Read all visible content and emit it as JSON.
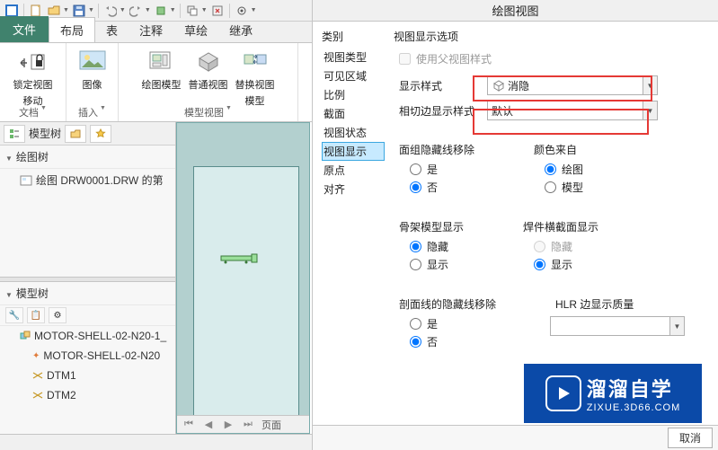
{
  "qat": {},
  "ribbon": {
    "tabs": {
      "file": "文件",
      "layout": "布局",
      "table": "表",
      "annotate": "注释",
      "sketch": "草绘",
      "inherit": "继承"
    },
    "groups": {
      "doc": {
        "lock_label1": "锁定视图",
        "lock_label2": "移动",
        "title": "文档"
      },
      "insert": {
        "image": "图像",
        "title": "插入"
      },
      "modelview": {
        "drawmodel": "绘图模型",
        "normalview": "普通视图",
        "replace_l1": "替换视图",
        "replace_l2": "模型",
        "title": "模型视图"
      }
    }
  },
  "leftpanel": {
    "tab_modeltree": "模型树",
    "tree_title": "绘图树",
    "drw_item": "绘图 DRW0001.DRW 的第",
    "tree2_title": "模型树",
    "item_asm1": "MOTOR-SHELL-02-N20-1_",
    "item_asm2": "MOTOR-SHELL-02-N20",
    "dtm1": "DTM1",
    "dtm2": "DTM2"
  },
  "drawnav": {
    "page": "页面"
  },
  "dialog": {
    "title": "绘图视图",
    "category_label": "类别",
    "categories": {
      "viewtype": "视图类型",
      "visiblearea": "可见区域",
      "scale": "比例",
      "section": "截面",
      "viewstate": "视图状态",
      "viewdisplay": "视图显示",
      "origin": "原点",
      "align": "对齐"
    },
    "options_label": "视图显示选项",
    "use_parent": "使用父视图样式",
    "display_style_label": "显示样式",
    "display_style_value": "消隐",
    "tangent_label": "相切边显示样式",
    "tangent_value": "默认",
    "facehidden_title": "面组隐藏线移除",
    "yes": "是",
    "no": "否",
    "colorfrom_title": "颜色来自",
    "color_draw": "绘图",
    "color_model": "模型",
    "skeleton_title": "骨架模型显示",
    "hide": "隐藏",
    "show": "显示",
    "weldcs_title": "焊件横截面显示",
    "hatchhidden_title": "剖面线的隐藏线移除",
    "hlr_title": "HLR 边显示质量",
    "btn_cancel": "取消"
  },
  "watermark": {
    "brand": "溜溜自学",
    "url": "ZIXUE.3D66.COM"
  }
}
